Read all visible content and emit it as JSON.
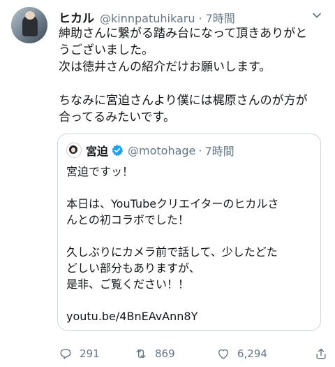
{
  "tweet": {
    "author_name": "ヒカル",
    "author_handle": "@kinnpatuhikaru",
    "separator": "·",
    "time": "7時間",
    "text_lines": [
      "紳助さんに繋がる踏み台になって頂きありがと",
      "うございました。",
      "次は徳井さんの紹介だけお願いします。",
      "",
      "ちなみに宮迫さんより僕には梶原さんのが方が",
      "合ってるみたいです。"
    ]
  },
  "quoted_tweet": {
    "author_name": "宮迫",
    "author_handle": "@motohage",
    "separator": "·",
    "time": "7時間",
    "text_lines": [
      "宮迫ですッ！",
      "",
      "本日は、YouTubeクリエイターのヒカルさ",
      "んとの初コラボでした！",
      "",
      "久しぶりにカメラ前で話して、少したどた",
      "どしい部分もありますが、",
      "是非、ご覧ください！！",
      "",
      "youtu.be/4BnEAvAnn8Y"
    ]
  },
  "actions": {
    "reply_count": "291",
    "retweet_count": "869",
    "like_count": "6,294"
  },
  "icons": [
    "chevron-down-icon",
    "verified-icon",
    "reply-icon",
    "retweet-icon",
    "like-icon",
    "share-icon"
  ],
  "colors": {
    "text": "#14171a",
    "muted": "#657786",
    "verified": "#1da1f2",
    "border": "#ccd6dd"
  }
}
